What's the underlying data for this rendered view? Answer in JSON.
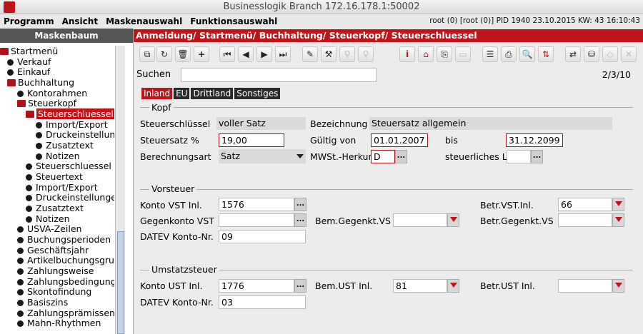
{
  "window": {
    "title": "Businesslogik Branch 172.16.178.1:50002"
  },
  "menu": [
    "Programm",
    "Ansicht",
    "Maskenauswahl",
    "Funktionsauswahl"
  ],
  "sysinfo": "root (0) [root (0)] PID 1940  23.10.2015 KW: 43  16:10:43",
  "sidebar": {
    "title": "Maskenbaum",
    "items": [
      "Startmenü",
      "Verkauf",
      "Einkauf",
      "Buchhaltung",
      "Kontorahmen",
      "Steuerkopf",
      "Steuerschluessel",
      "Import/Export",
      "Druckeinstellun",
      "Zusatztext",
      "Notizen",
      "Steuerschluessel",
      "Steuertext",
      "Import/Export",
      "Druckeinstellungen",
      "Zusatztext",
      "Notizen",
      "USVA-Zeilen",
      "Buchungsperioden",
      "Geschäftsjahr",
      "Artikelbuchungsgru",
      "Zahlungsweise",
      "Zahlungsbedingung",
      "Skontofindung",
      "Basiszins",
      "Zahlungsprämissen",
      "Mahn-Rhythmen"
    ]
  },
  "breadcrumb": "Anmeldung/ Startmenü/ Buchhaltung/ Steuerkopf/ Steuerschluessel",
  "search": {
    "label": "Suchen",
    "value": ""
  },
  "pager": "2/3/10",
  "tabs": [
    "Inland",
    "EU",
    "Drittland",
    "Sonstiges"
  ],
  "kopf": {
    "title": "Kopf",
    "steuerschluessel_label": "Steuerschlüssel",
    "steuerschluessel": "voller Satz",
    "bezeichnung_label": "Bezeichnung",
    "bezeichnung": "Steuersatz allgemein",
    "steuersatz_label": "Steuersatz %",
    "steuersatz": "19,00",
    "gueltig_label": "Gültig von",
    "gueltig_von": "01.01.2007",
    "bis_label": "bis",
    "bis": "31.12.2099",
    "berechnungsart_label": "Berechnungsart",
    "berechnungsart": "Satz",
    "mwst_label": "MWSt.-Herkun",
    "mwst": "D",
    "steuerlich_label": "steuerliches L",
    "steuerlich": ""
  },
  "vorsteuer": {
    "title": "Vorsteuer",
    "konto_label": "Konto VST Inl.",
    "konto": "1576",
    "betr_label": "Betr.VST.Inl.",
    "betr": "66",
    "gegen_label": "Gegenkonto VST",
    "gegen": "",
    "bemgeg_label": "Bem.Gegenkt.VS",
    "bemgeg": "",
    "betrgeg_label": "Betr.Gegenkt.VS",
    "betrgeg": "",
    "datev_label": "DATEV Konto-Nr.",
    "datev": "09"
  },
  "umsatz": {
    "title": "Umstatzsteuer",
    "konto_label": "Konto UST Inl.",
    "konto": "1776",
    "bem_label": "Bem.UST Inl.",
    "bem": "81",
    "betr_label": "Betr.UST Inl.",
    "betr": "",
    "datev_label": "DATEV Konto-Nr.",
    "datev": "03"
  },
  "toolbar": [
    "copy",
    "refresh",
    "delete",
    "add",
    "first",
    "prev",
    "next",
    "last",
    "edit",
    "tool",
    "disabled",
    "disabled",
    "info",
    "home",
    "export",
    "disabled",
    "list",
    "print",
    "search",
    "sort",
    "swap",
    "save",
    "disabled",
    "disabled"
  ]
}
